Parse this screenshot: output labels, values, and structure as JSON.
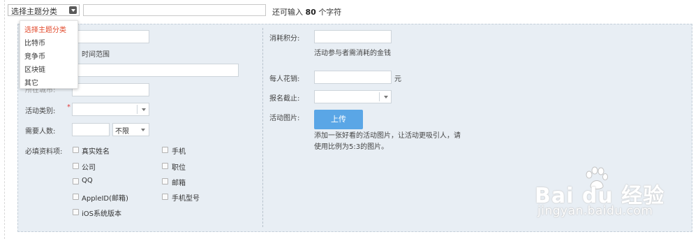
{
  "topbar": {
    "category_select": "选择主题分类",
    "remaining_prefix": "还可输入",
    "remaining_count": "80",
    "remaining_suffix": "个字符"
  },
  "dropdown": {
    "items": [
      "选择主题分类",
      "比特币",
      "竞争币",
      "区块链",
      "其它"
    ],
    "selected_index": 0,
    "selected_color": "#e24a2c"
  },
  "form_left": {
    "time_range_hint": "时间范围",
    "partial_label": "所在城市:",
    "activity_type_label": "活动类别:",
    "required_mark": "*",
    "people_label": "需要人数:",
    "people_unit": "不限",
    "required_fields_label": "必填资料项:",
    "checkboxes_col1": [
      "真实姓名",
      "公司",
      "QQ",
      "AppleID(邮箱)",
      "iOS系统版本"
    ],
    "checkboxes_col2": [
      "手机",
      "职位",
      "邮箱",
      "手机型号"
    ]
  },
  "form_right": {
    "points_label": "消耗积分:",
    "points_hint": "活动参与者需消耗的金钱",
    "cost_label": "每人花销:",
    "cost_unit": "元",
    "deadline_label": "报名截止:",
    "image_label": "活动图片:",
    "upload_button": "上传",
    "image_hint_line1": "添加一张好看的活动图片，让活动更吸引人，请",
    "image_hint_line2": "使用比例为5:3的图片。"
  },
  "watermark": {
    "brand": "Bai du 经验",
    "url": "jingyan.baidu.com"
  },
  "colors": {
    "panel_bg": "#e8eef4",
    "upload_button": "#5aa6e6",
    "required": "#e23b3b"
  }
}
